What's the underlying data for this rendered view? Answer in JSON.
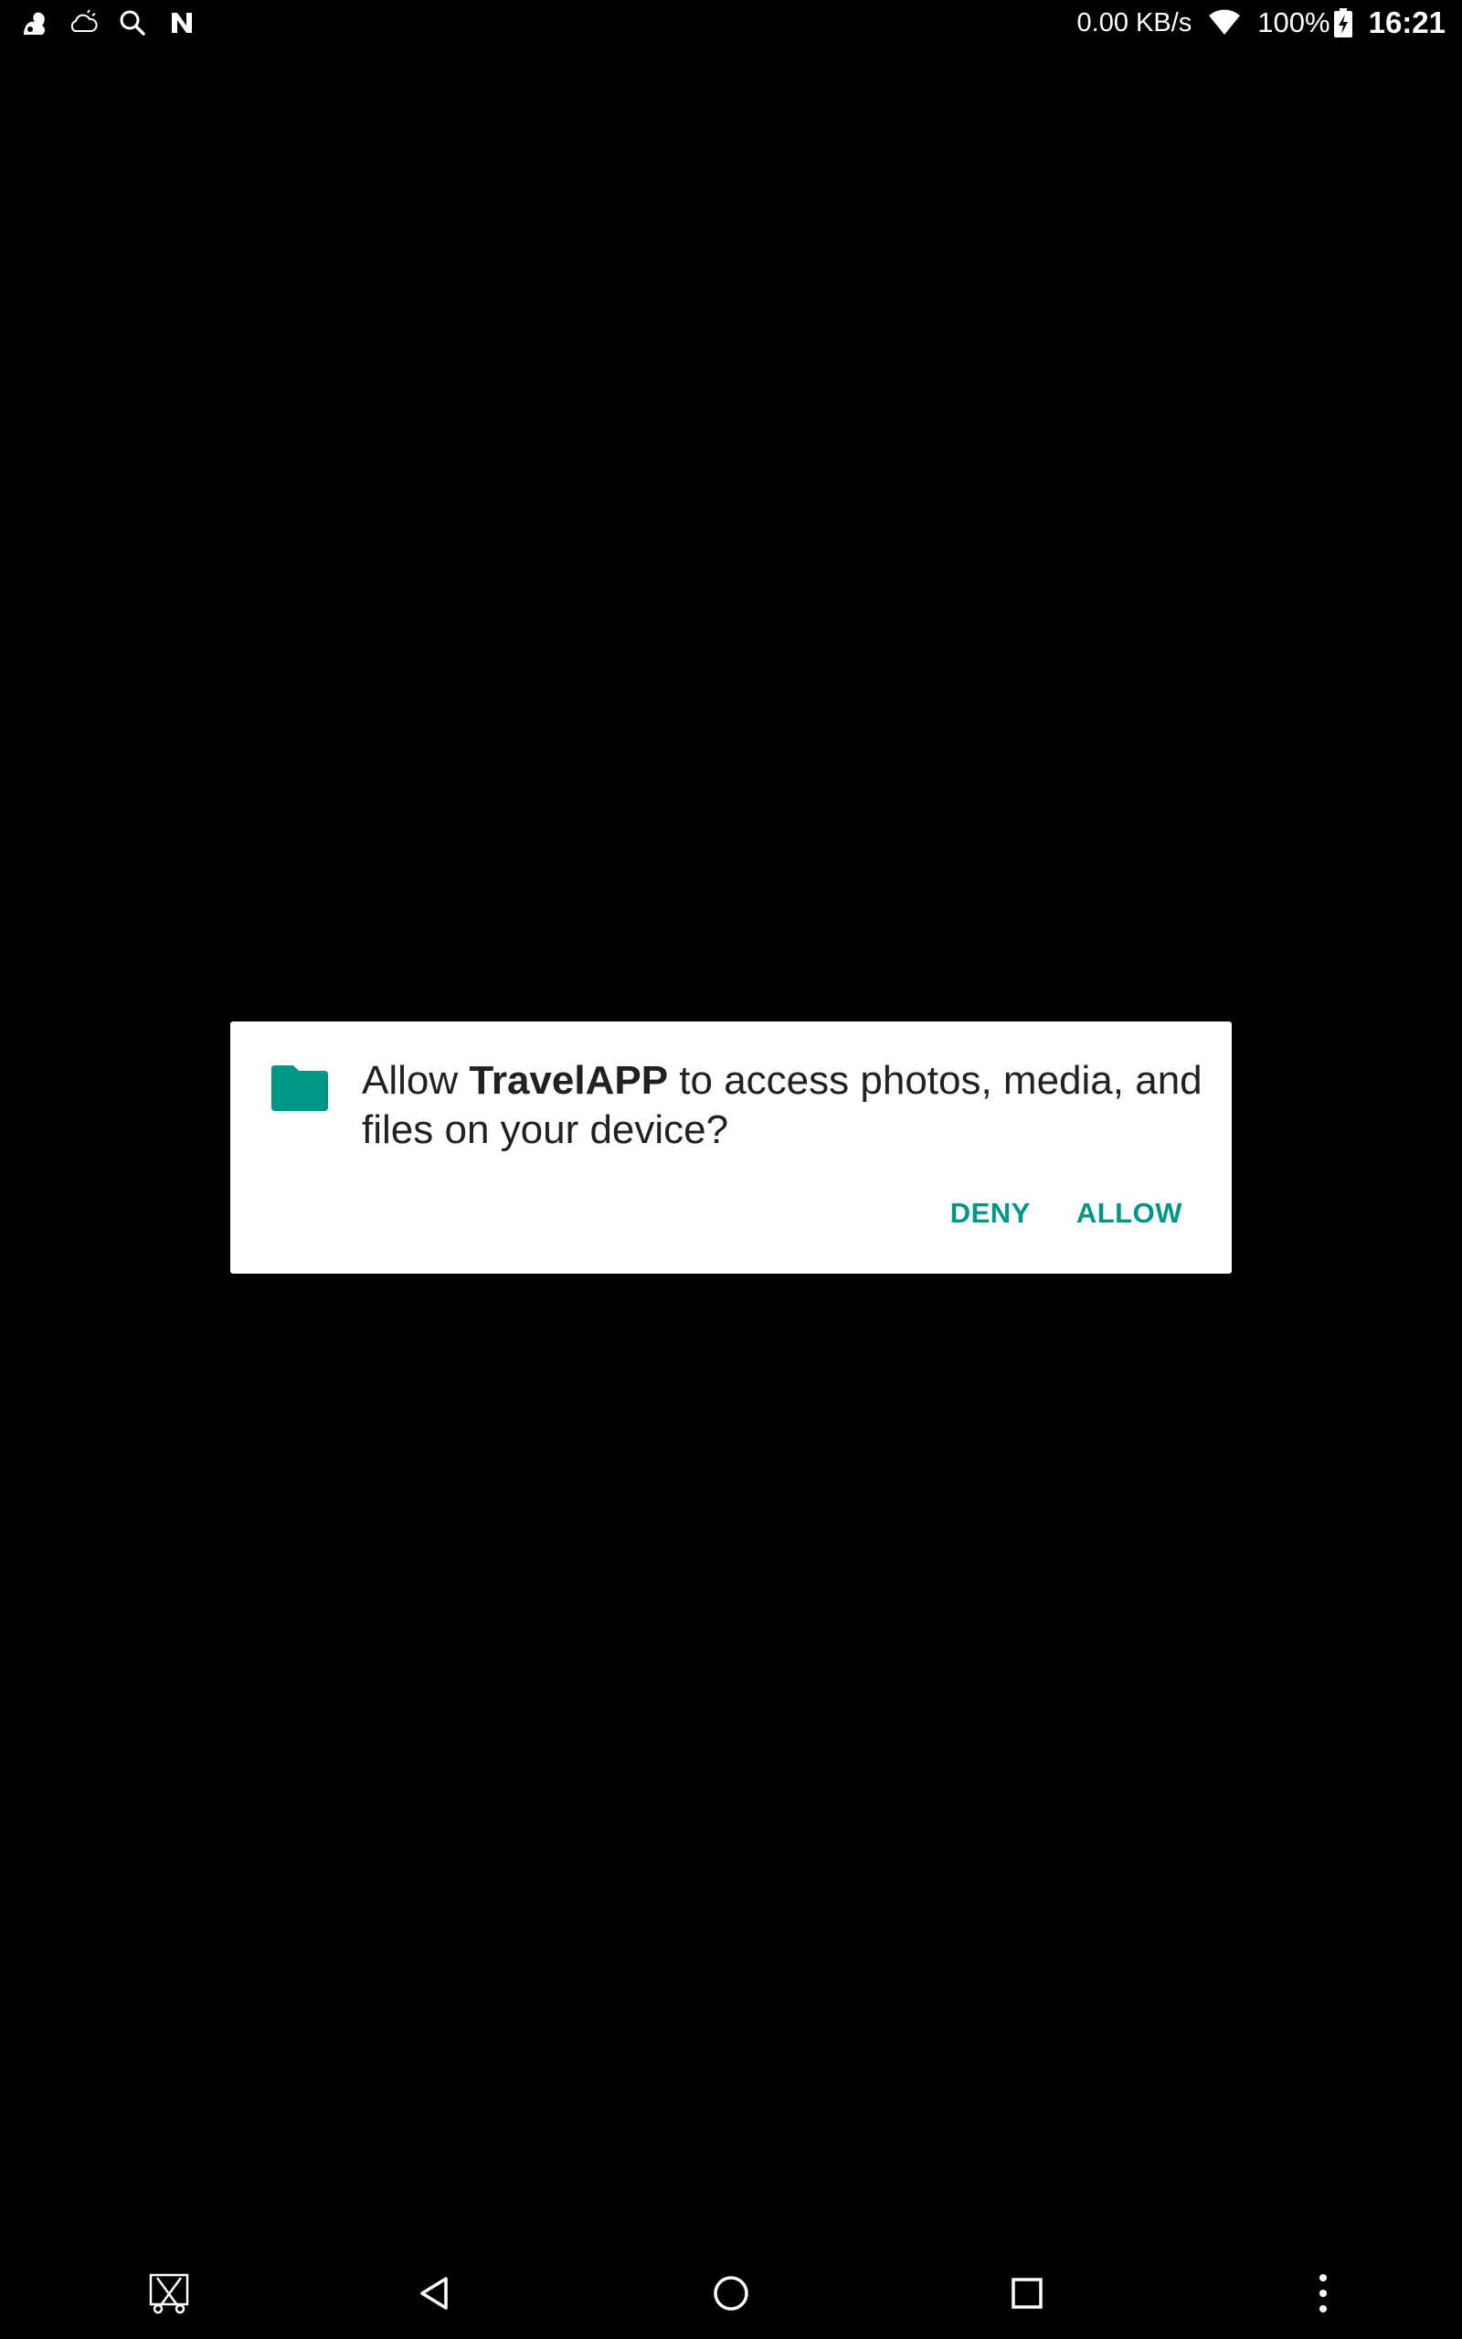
{
  "status_bar": {
    "left_icons": [
      "squirrel-app-icon",
      "weather-cloud-icon",
      "search-icon",
      "n-app-icon"
    ],
    "net_speed": "0.00 KB/s",
    "wifi_icon": "wifi-icon",
    "battery_percent": "100%",
    "battery_icon": "battery-charging-icon",
    "time": "16:21"
  },
  "dialog": {
    "icon": "folder-icon",
    "message_prefix": "Allow ",
    "app_name": "TravelAPP",
    "message_suffix": " to access photos, media, and files on your device?",
    "deny_label": "DENY",
    "allow_label": "ALLOW",
    "accent_color": "#009688"
  },
  "nav_bar": {
    "buttons": [
      "screenshot-icon",
      "back-icon",
      "home-icon",
      "recents-icon",
      "more-vert-icon"
    ]
  }
}
